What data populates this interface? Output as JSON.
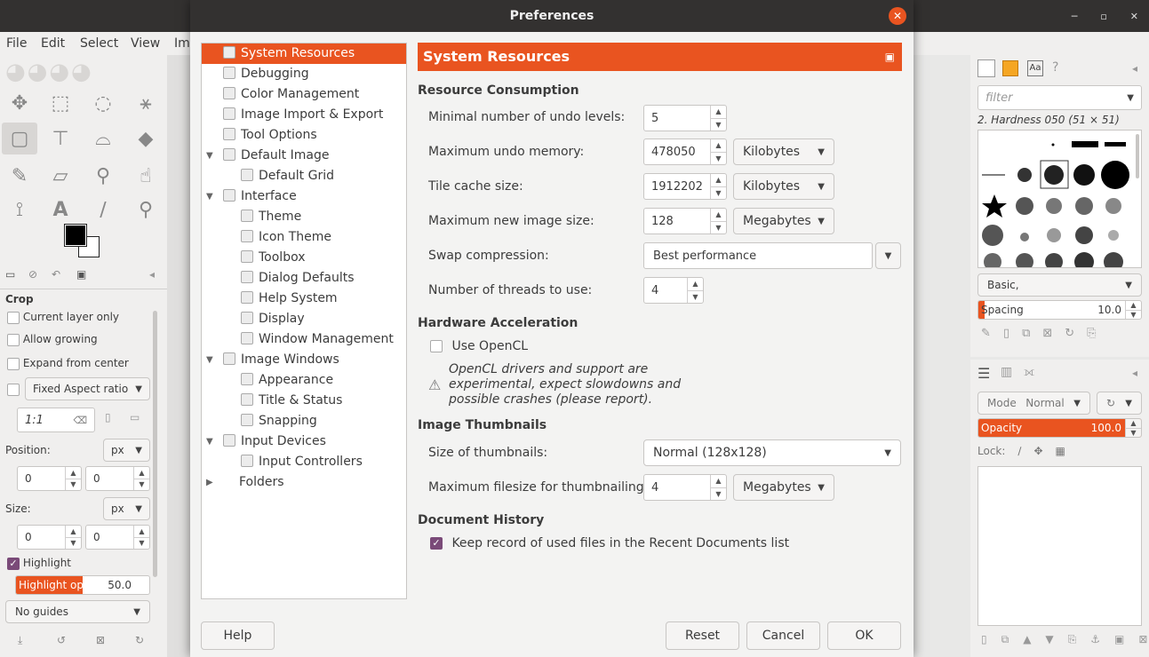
{
  "colors": {
    "accent": "#e95420",
    "checkbox": "#7a4a78",
    "titlebar": "#333130"
  },
  "gimp_menu": [
    "File",
    "Edit",
    "Select",
    "View",
    "Im"
  ],
  "tool_options": {
    "title": "Crop",
    "current_layer_only": "Current layer only",
    "allow_growing": "Allow growing",
    "expand_from_center": "Expand from center",
    "fixed": "Fixed",
    "aspect_ratio": "Aspect ratio",
    "ratio_value": "1:1",
    "position_label": "Position:",
    "position_unit": "px",
    "pos_x": "0",
    "pos_y": "0",
    "size_label": "Size:",
    "size_unit": "px",
    "size_w": "0",
    "size_h": "0",
    "highlight": "Highlight",
    "highlight_opacity_label": "Highlight opa…",
    "highlight_opacity_value": "50.0",
    "highlight_opacity_fraction": 0.5,
    "guides": "No guides"
  },
  "dialog": {
    "title": "Preferences",
    "tree": [
      {
        "label": "System Resources",
        "indent": 0,
        "arrow": "",
        "selected": true,
        "icon": "chip-icon"
      },
      {
        "label": "Debugging",
        "indent": 0,
        "arrow": "",
        "icon": "bug-icon"
      },
      {
        "label": "Color Management",
        "indent": 0,
        "arrow": "",
        "icon": "palette-icon"
      },
      {
        "label": "Image Import & Export",
        "indent": 0,
        "arrow": "",
        "icon": "image-io-icon"
      },
      {
        "label": "Tool Options",
        "indent": 0,
        "arrow": "",
        "icon": "tool-options-icon"
      },
      {
        "label": "Default Image",
        "indent": 0,
        "arrow": "▼",
        "icon": "default-image-icon"
      },
      {
        "label": "Default Grid",
        "indent": 1,
        "arrow": "",
        "icon": "grid-icon"
      },
      {
        "label": "Interface",
        "indent": 0,
        "arrow": "▼",
        "icon": "interface-icon"
      },
      {
        "label": "Theme",
        "indent": 1,
        "arrow": "",
        "icon": "theme-icon"
      },
      {
        "label": "Icon Theme",
        "indent": 1,
        "arrow": "",
        "icon": "icon-theme-icon"
      },
      {
        "label": "Toolbox",
        "indent": 1,
        "arrow": "",
        "icon": "toolbox-icon"
      },
      {
        "label": "Dialog Defaults",
        "indent": 1,
        "arrow": "",
        "icon": "dialog-defaults-icon"
      },
      {
        "label": "Help System",
        "indent": 1,
        "arrow": "",
        "icon": "help-system-icon"
      },
      {
        "label": "Display",
        "indent": 1,
        "arrow": "",
        "icon": "display-icon"
      },
      {
        "label": "Window Management",
        "indent": 1,
        "arrow": "",
        "icon": "window-management-icon"
      },
      {
        "label": "Image Windows",
        "indent": 0,
        "arrow": "▼",
        "icon": "image-windows-icon"
      },
      {
        "label": "Appearance",
        "indent": 1,
        "arrow": "",
        "icon": "appearance-icon"
      },
      {
        "label": "Title & Status",
        "indent": 1,
        "arrow": "",
        "icon": "title-status-icon"
      },
      {
        "label": "Snapping",
        "indent": 1,
        "arrow": "",
        "icon": "snapping-icon"
      },
      {
        "label": "Input Devices",
        "indent": 0,
        "arrow": "▼",
        "icon": "input-devices-icon"
      },
      {
        "label": "Input Controllers",
        "indent": 1,
        "arrow": "",
        "icon": "input-controllers-icon"
      },
      {
        "label": "Folders",
        "indent": 0,
        "arrow": "▶",
        "noicon": true,
        "icon": "folders-icon"
      }
    ],
    "header": "System Resources",
    "sections": {
      "resource": "Resource Consumption",
      "hardware": "Hardware Acceleration",
      "thumbs": "Image Thumbnails",
      "history": "Document History"
    },
    "fields": {
      "undo_levels_label": "Minimal number of undo levels:",
      "undo_levels": "5",
      "undo_memory_label": "Maximum undo memory:",
      "undo_memory": "478050",
      "undo_memory_unit": "Kilobytes",
      "tile_cache_label": "Tile cache size:",
      "tile_cache": "1912202",
      "tile_cache_unit": "Kilobytes",
      "max_image_label": "Maximum new image size:",
      "max_image": "128",
      "max_image_unit": "Megabytes",
      "swap_label": "Swap compression:",
      "swap": "Best performance",
      "threads_label": "Number of threads to use:",
      "threads": "4",
      "opencl_label": "Use OpenCL",
      "opencl_warning": "OpenCL drivers and support are experimental, expect slowdowns and possible crashes (please report).",
      "thumb_size_label": "Size of thumbnails:",
      "thumb_size": "Normal (128x128)",
      "thumb_filesize_label": "Maximum filesize for thumbnailing:",
      "thumb_filesize": "4",
      "thumb_filesize_unit": "Megabytes",
      "recent_docs_label": "Keep record of used files in the Recent Documents list"
    },
    "buttons": {
      "help": "Help",
      "reset": "Reset",
      "cancel": "Cancel",
      "ok": "OK"
    }
  },
  "brushes": {
    "filter_placeholder": "filter",
    "current": "2. Hardness 050 (51 × 51)",
    "tag": "Basic,",
    "spacing_label": "Spacing",
    "spacing_value": "10.0",
    "spacing_fraction": 0.04
  },
  "layers": {
    "mode_label": "Mode",
    "mode_value": "Normal",
    "opacity_label": "Opacity",
    "opacity_value": "100.0",
    "lock_label": "Lock:"
  }
}
